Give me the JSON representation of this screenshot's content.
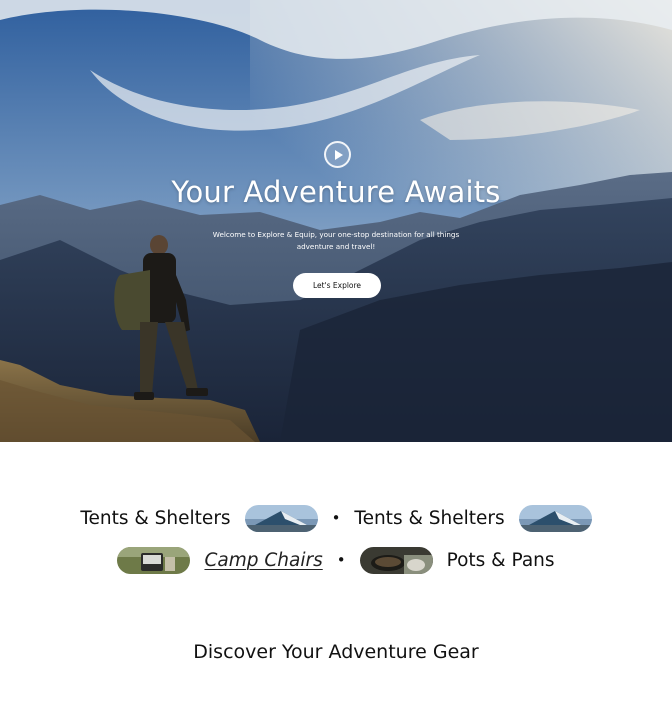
{
  "hero": {
    "title": "Your Adventure Awaits",
    "subtitle": "Welcome to Explore & Equip, your one-stop destination for all things adventure and travel!",
    "cta_label": "Let's Explore",
    "play_icon": "play-icon"
  },
  "categories": {
    "row1": [
      {
        "label": "Tents & Shelters",
        "thumb": "tent-thumbnail"
      },
      {
        "label": "Tents & Shelters",
        "thumb": "tent-thumbnail"
      }
    ],
    "row2": [
      {
        "label": "Camp Chairs",
        "thumb": "camp-chair-thumbnail"
      },
      {
        "label": "Pots & Pans",
        "thumb": "pots-pans-thumbnail"
      }
    ],
    "separator": "•"
  },
  "section": {
    "title": "Discover Your Adventure Gear"
  },
  "colors": {
    "sky_top": "#3f6fa8",
    "sky_bottom": "#c9d6e2",
    "mountain_dark": "#1f2d45",
    "cta_bg": "#ffffff"
  }
}
